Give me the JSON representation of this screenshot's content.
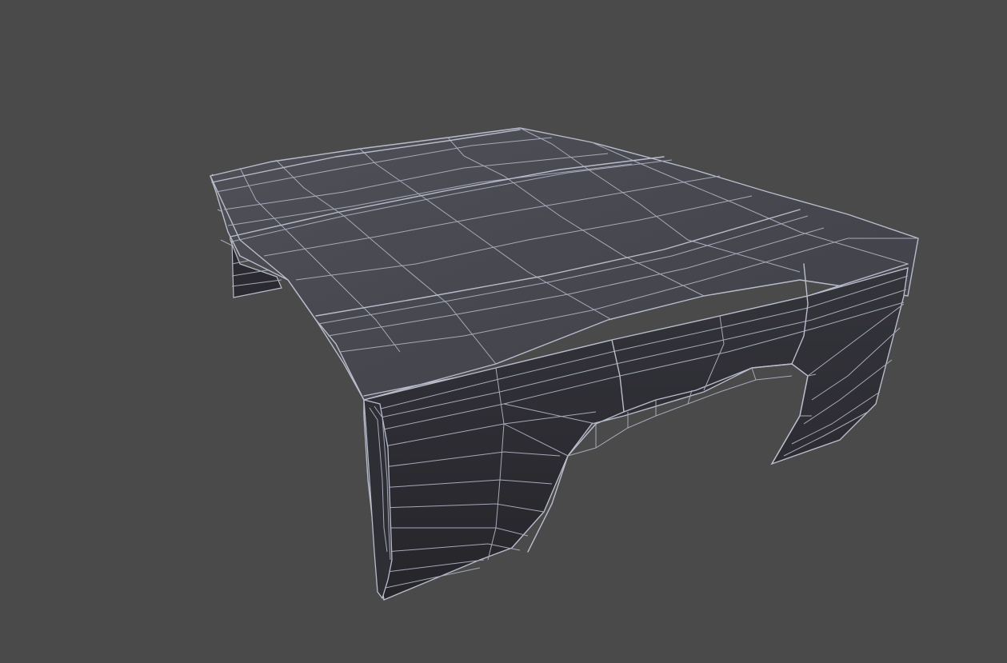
{
  "viewport": {
    "background": "#4a4a4a",
    "wire_color": "#b9bccb",
    "face_colors": {
      "top": "#4a4a52",
      "top_dark": "#3b3b43",
      "side": "#2c2c32",
      "side_dark": "#222227"
    }
  },
  "model": {
    "kind": "truck-bed-panel-mesh",
    "shading": "smooth-with-wireframe"
  }
}
